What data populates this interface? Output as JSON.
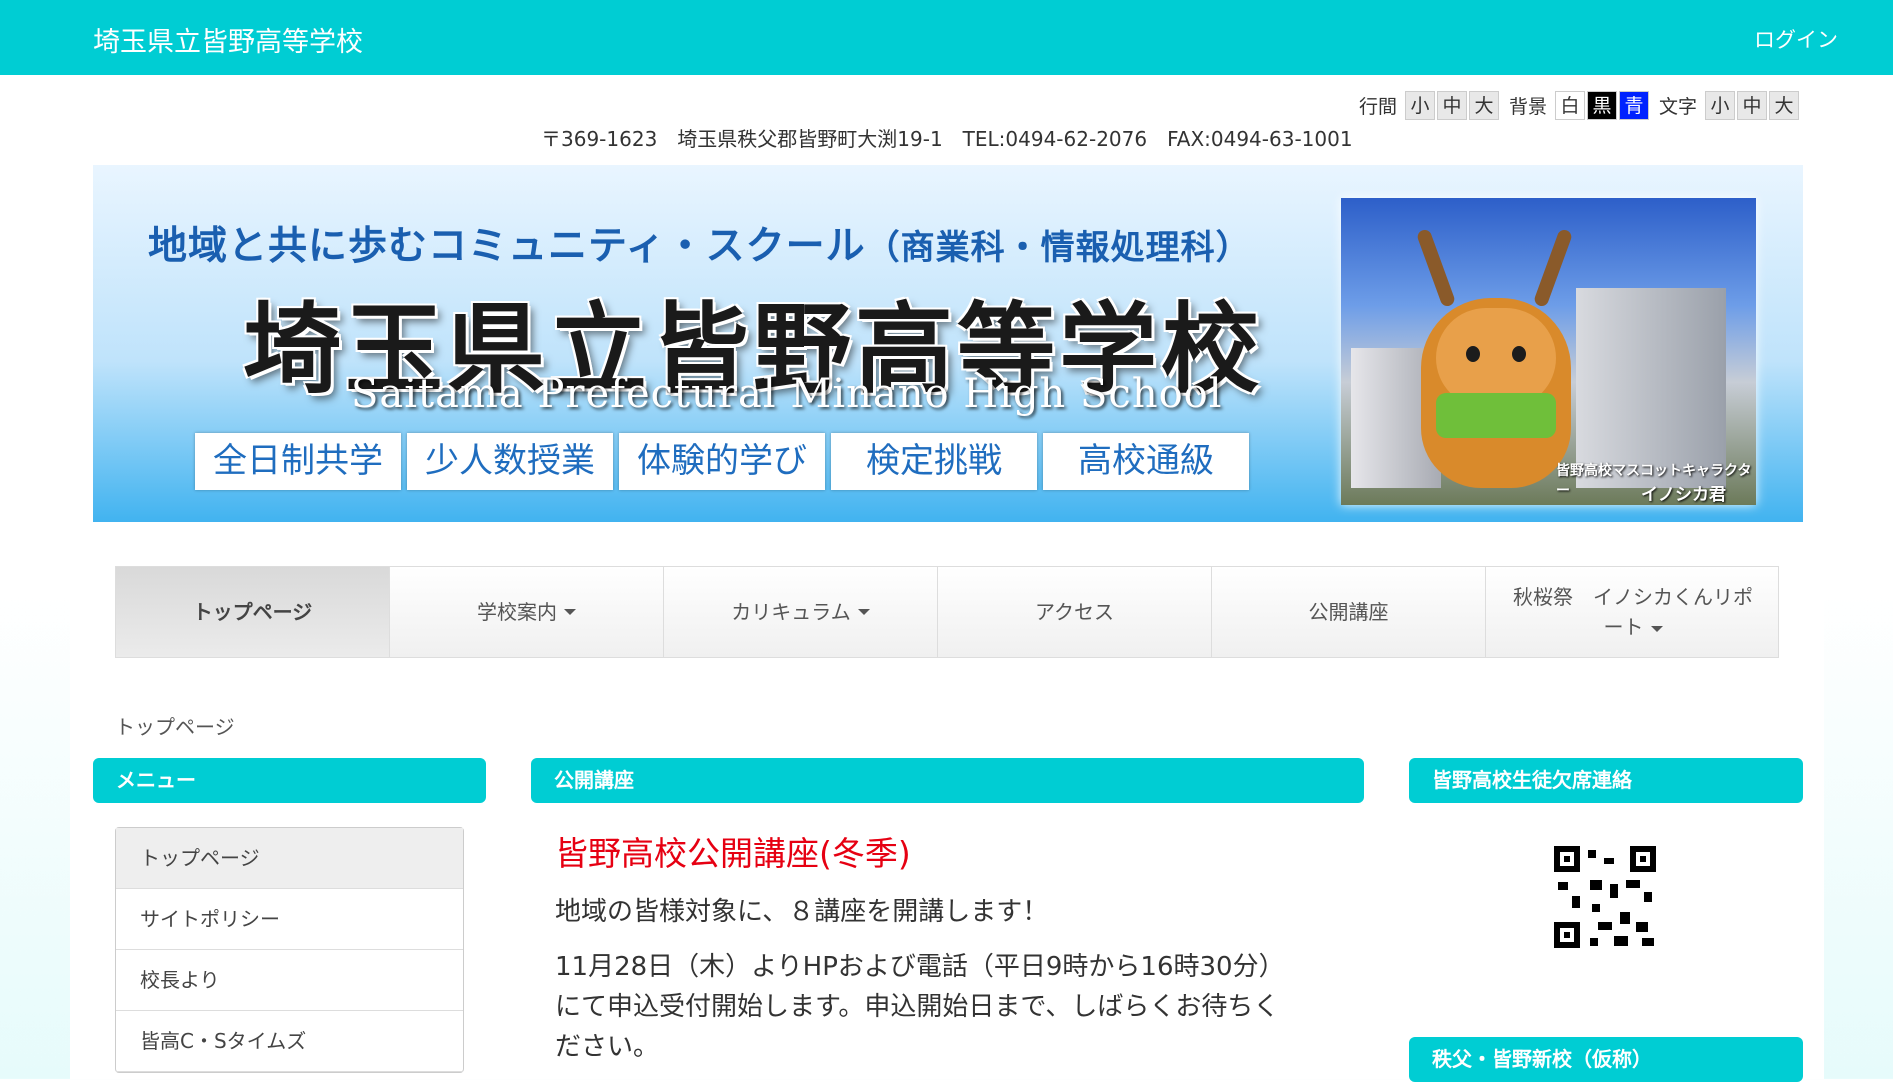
{
  "header": {
    "site_name": "埼玉県立皆野高等学校",
    "login": "ログイン"
  },
  "accessibility": {
    "line_spacing_label": "行間",
    "line_spacing_options": [
      "小",
      "中",
      "大"
    ],
    "background_label": "背景",
    "background_options": [
      "白",
      "黒",
      "青"
    ],
    "font_label": "文字",
    "font_options": [
      "小",
      "中",
      "大"
    ]
  },
  "address": "〒369-1623　埼玉県秩父郡皆野町大渕19-1　TEL:0494-62-2076　FAX:0494-63-1001",
  "banner": {
    "tagline_main": "地域と共に歩むコミュニティ・スクール",
    "tagline_paren": "（商業科・情報処理科）",
    "school_name": "埼玉県立皆野高等学校",
    "english_name": "Saitama Prefectural Minano High School",
    "features": [
      "全日制共学",
      "少人数授業",
      "体験的学び",
      "検定挑戦",
      "高校通級"
    ],
    "mascot_caption": "皆野高校マスコットキャラクター",
    "mascot_name": "イノシカ君"
  },
  "nav": {
    "items": [
      {
        "label": "トップページ",
        "dropdown": false
      },
      {
        "label": "学校案内",
        "dropdown": true
      },
      {
        "label": "カリキュラム",
        "dropdown": true
      },
      {
        "label": "アクセス",
        "dropdown": false
      },
      {
        "label": "公開講座",
        "dropdown": false
      },
      {
        "label": "秋桜祭　イノシカくんリポート",
        "dropdown": true
      }
    ]
  },
  "breadcrumb": "トップページ",
  "left_box": {
    "title": "メニュー",
    "items": [
      "トップページ",
      "サイトポリシー",
      "校長より",
      "皆高C・Sタイムズ"
    ]
  },
  "center_box": {
    "title": "公開講座",
    "article_title": "皆野高校公開講座(冬季)",
    "paragraph_1": "地域の皆様対象に、８講座を開講します！",
    "paragraph_2_line_1": "11月28日（木）よりHPおよび電話（平日9時から16時30分）",
    "paragraph_2_line_2": "にて申込受付開始します。申込開始日まで、しばらくお待ちく",
    "paragraph_2_line_3": "ださい。"
  },
  "right_box": {
    "title": "皆野高校生徒欠席連絡",
    "title_2": "秩父・皆野新校（仮称）"
  },
  "colors": {
    "accent": "#00cdd3",
    "article_title": "#e60012"
  }
}
